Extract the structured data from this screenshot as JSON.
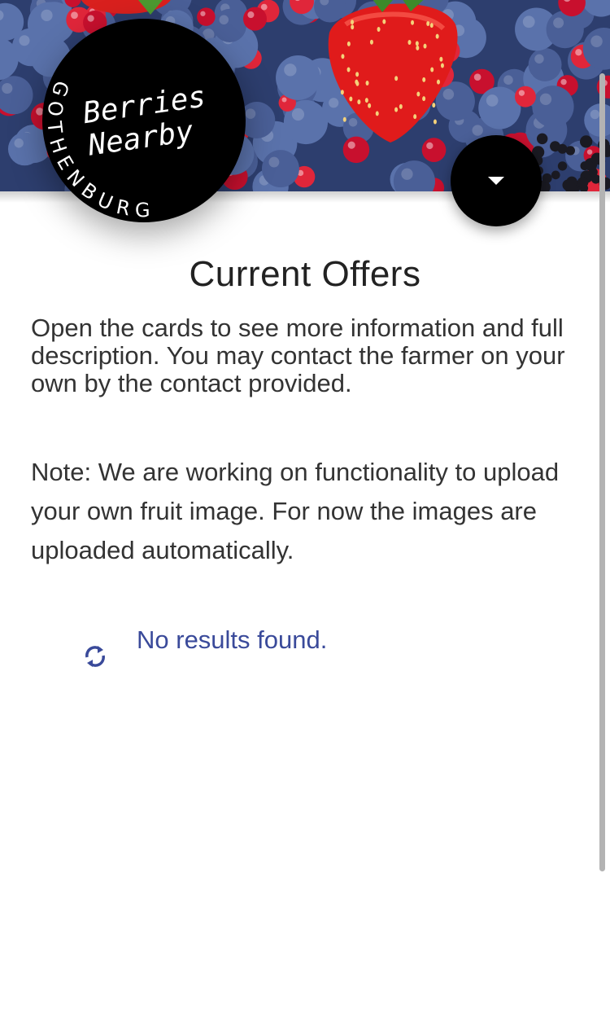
{
  "logo": {
    "line1": "Berries",
    "line2": "Nearby",
    "ring_text": "GOTHENBURG"
  },
  "header": {
    "menu_icon": "caret-down-icon"
  },
  "main": {
    "title": "Current Offers",
    "intro": "Open the cards to see more information and full description. You may contact the farmer on your own by the contact provided.",
    "note": "Note: We are working on functionality to upload your own fruit image. For now the images are uploaded automatically."
  },
  "results": {
    "icon": "refresh-icon",
    "message": "No results found."
  },
  "colors": {
    "accent": "#3a4a9a",
    "logo_bg": "#000000",
    "text": "#333333"
  }
}
